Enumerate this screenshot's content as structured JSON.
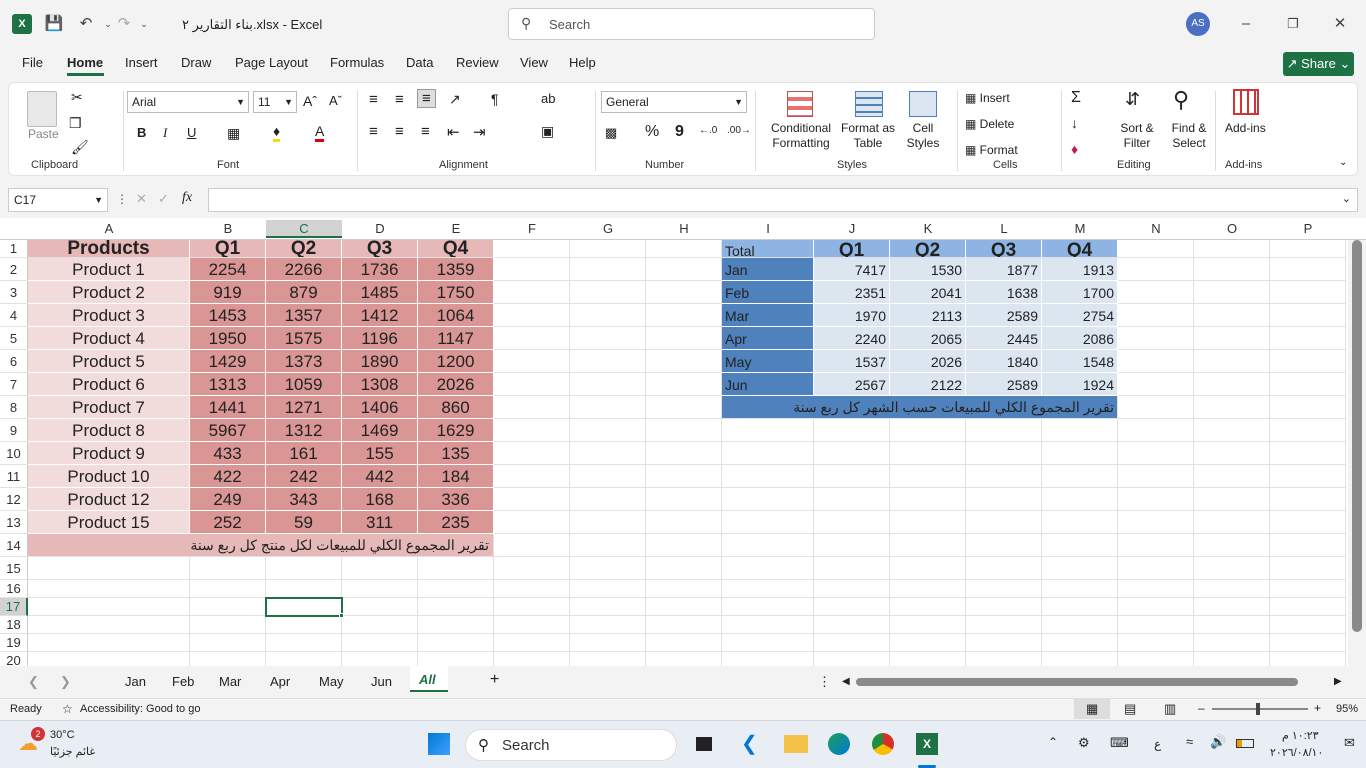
{
  "title": {
    "filename": "بناء التقارير ٢.xlsx",
    "app": "Excel",
    "search_placeholder": "Search",
    "avatar": "AS"
  },
  "menu": [
    "File",
    "Home",
    "Insert",
    "Draw",
    "Page Layout",
    "Formulas",
    "Data",
    "Review",
    "View",
    "Help"
  ],
  "share_label": "Share",
  "ribbon": {
    "clipboard": {
      "paste": "Paste",
      "label": "Clipboard"
    },
    "font": {
      "family": "Arial",
      "size": "11",
      "label": "Font",
      "bold": "B",
      "italic": "I",
      "underline": "U"
    },
    "alignment": {
      "label": "Alignment"
    },
    "number": {
      "format": "General",
      "label": "Number",
      "percent": "%",
      "comma": "9"
    },
    "styles": {
      "conditional": "Conditional Formatting",
      "format_table": "Format as Table",
      "cell_styles": "Cell Styles",
      "label": "Styles"
    },
    "cells": {
      "insert": "Insert",
      "delete": "Delete",
      "format": "Format",
      "label": "Cells"
    },
    "editing": {
      "sort": "Sort & Filter",
      "find": "Find & Select",
      "label": "Editing"
    },
    "addins": {
      "button": "Add-ins",
      "label": "Add-ins"
    }
  },
  "formula_bar": {
    "name_box": "C17",
    "fx": "fx",
    "content": ""
  },
  "columns": [
    "A",
    "B",
    "C",
    "D",
    "E",
    "F",
    "G",
    "H",
    "I",
    "J",
    "K",
    "L",
    "M",
    "N",
    "O",
    "P"
  ],
  "rows": [
    "1",
    "2",
    "3",
    "4",
    "5",
    "6",
    "7",
    "8",
    "9",
    "10",
    "11",
    "12",
    "13",
    "14",
    "15",
    "16",
    "17",
    "18",
    "19",
    "20"
  ],
  "table1": {
    "headers": [
      "Products",
      "Q1",
      "Q2",
      "Q3",
      "Q4"
    ],
    "rows": [
      [
        "Product 1",
        "2254",
        "2266",
        "1736",
        "1359"
      ],
      [
        "Product 2",
        "919",
        "879",
        "1485",
        "1750"
      ],
      [
        "Product 3",
        "1453",
        "1357",
        "1412",
        "1064"
      ],
      [
        "Product 4",
        "1950",
        "1575",
        "1196",
        "1147"
      ],
      [
        "Product 5",
        "1429",
        "1373",
        "1890",
        "1200"
      ],
      [
        "Product 6",
        "1313",
        "1059",
        "1308",
        "2026"
      ],
      [
        "Product 7",
        "1441",
        "1271",
        "1406",
        "860"
      ],
      [
        "Product 8",
        "5967",
        "1312",
        "1469",
        "1629"
      ],
      [
        "Product 9",
        "433",
        "161",
        "155",
        "135"
      ],
      [
        "Product 10",
        "422",
        "242",
        "442",
        "184"
      ],
      [
        "Product 12",
        "249",
        "343",
        "168",
        "336"
      ],
      [
        "Product 15",
        "252",
        "59",
        "311",
        "235"
      ]
    ],
    "caption": "تقرير المجموع الكلي للمبيعات لكل منتج كل ربع سنة"
  },
  "table2": {
    "headers": [
      "Total",
      "Q1",
      "Q2",
      "Q3",
      "Q4"
    ],
    "rows": [
      [
        "Jan",
        "7417",
        "1530",
        "1877",
        "1913"
      ],
      [
        "Feb",
        "2351",
        "2041",
        "1638",
        "1700"
      ],
      [
        "Mar",
        "1970",
        "2113",
        "2589",
        "2754"
      ],
      [
        "Apr",
        "2240",
        "2065",
        "2445",
        "2086"
      ],
      [
        "May",
        "1537",
        "2026",
        "1840",
        "1548"
      ],
      [
        "Jun",
        "2567",
        "2122",
        "2589",
        "1924"
      ]
    ],
    "caption": "تقرير المجموع الكلي للمبيعات حسب الشهر كل ربع سنة"
  },
  "sheets": [
    "Jan",
    "Feb",
    "Mar",
    "Apr",
    "May",
    "Jun",
    "All"
  ],
  "active_sheet": "All",
  "status": {
    "ready": "Ready",
    "accessibility": "Accessibility: Good to go",
    "zoom": "95%"
  },
  "taskbar": {
    "temp": "30°C",
    "weather": "غائم جزئيًا",
    "badge": "2",
    "search": "Search",
    "time": "١٠:٢٣ م",
    "date": "٢٠٢٦/٠٨/١٠",
    "lang": "ع"
  },
  "colors": {
    "excel_green": "#1e7145",
    "pink_header": "#e6b8b7",
    "pink_light": "#f2dcdb",
    "pink_mid": "#da9694",
    "blue_header": "#8db4e2",
    "blue_dark": "#4f81bd",
    "blue_light": "#dce6f1"
  }
}
